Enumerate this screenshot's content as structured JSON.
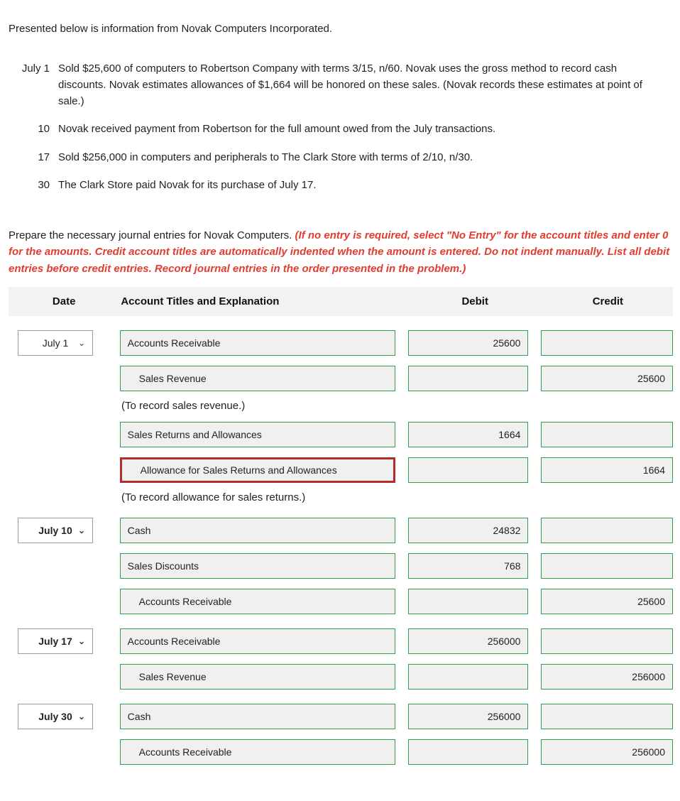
{
  "intro": "Presented below is information from Novak Computers Incorporated.",
  "events": [
    {
      "date": "July 1",
      "text": "Sold $25,600 of computers to Robertson Company with terms 3/15, n/60. Novak uses the gross method to record cash discounts. Novak estimates allowances of $1,664 will be honored on these sales. (Novak records these estimates at point of sale.)"
    },
    {
      "date": "10",
      "text": "Novak received payment from Robertson for the full amount owed from the July transactions."
    },
    {
      "date": "17",
      "text": "Sold $256,000 in computers and peripherals to The Clark Store with terms of 2/10, n/30."
    },
    {
      "date": "30",
      "text": "The Clark Store paid Novak for its purchase of July 17."
    }
  ],
  "instruction_plain": "Prepare the necessary journal entries for Novak Computers. ",
  "instruction_red": "(If no entry is required, select \"No Entry\" for the account titles and enter 0 for the amounts. Credit account titles are automatically indented when the amount is entered. Do not indent manually. List all debit entries before credit entries. Record journal entries in the order presented in the problem.)",
  "headers": {
    "date": "Date",
    "account": "Account Titles and Explanation",
    "debit": "Debit",
    "credit": "Credit"
  },
  "dates": {
    "d1": "July 1",
    "d2": "July 10",
    "d3": "July 17",
    "d4": "July 30"
  },
  "accounts": {
    "ar": "Accounts Receivable",
    "sales_rev": "Sales Revenue",
    "sra": "Sales Returns and Allowances",
    "allow_sra": "Allowance for Sales Returns and Allowances",
    "cash": "Cash",
    "sales_disc": "Sales Discounts"
  },
  "explain": {
    "e1": "(To record sales revenue.)",
    "e2": "(To record allowance for sales returns.)"
  },
  "amounts": {
    "v25600": "25600",
    "v1664": "1664",
    "v24832": "24832",
    "v768": "768",
    "v256000": "256000"
  }
}
